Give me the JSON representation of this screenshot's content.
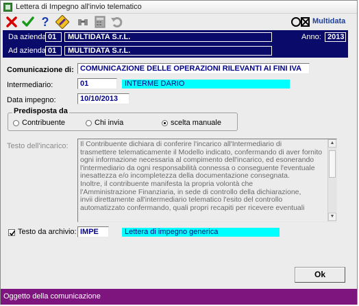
{
  "window": {
    "title": "Lettera di Impegno all'invio telematico"
  },
  "toolbar": {
    "buttons": [
      "cancel-icon",
      "confirm-icon",
      "help-icon",
      "edit-icon",
      "search-icon",
      "calculator-icon",
      "undo-icon"
    ]
  },
  "logo": {
    "text": "Multidata"
  },
  "header": {
    "da_azienda_label": "Da azienda:",
    "da_azienda_code": "01",
    "da_azienda_name": "MULTIDATA S.r.L.",
    "anno_label": "Anno:",
    "anno_value": "2013",
    "ad_azienda_label": "Ad azienda:",
    "ad_azienda_code": "01",
    "ad_azienda_name": "MULTIDATA S.r.L."
  },
  "form": {
    "comunicazione_label": "Comunicazione di:",
    "comunicazione_value": "COMUNICAZIONE DELLE OPERAZIONI RILEVANTI AI FINI IVA",
    "intermediario_label": "Intermediario:",
    "intermediario_code": "01",
    "intermediario_name": "INTERME DARIO",
    "data_impegno_label": "Data impegno:",
    "data_impegno_value": "10/10/2013",
    "predisposta_title": "Predisposta da",
    "radio_options": [
      {
        "label": "Contribuente",
        "selected": false
      },
      {
        "label": "Chi invia",
        "selected": false
      },
      {
        "label": "scelta manuale",
        "selected": true
      }
    ],
    "testo_label": "Testo dell'incarico:",
    "testo_lines": [
      "Il Contribuente dichiara di conferire l'incarico all'Intermediario di",
      "trasmettere telematicamente il Modello indicato, confermando di aver fornito",
      "ogni informazione necessaria al compimento dell'incarico, ed esonerando",
      "l'intermediario da ogni responsabilità connessa o conseguente l'eventuale",
      "inesattezza e/o incompletezza della documentazione consegnata.",
      "Inoltre, il contribuente manifesta la propria volontà che",
      "l'Amministrazione Finanziaria, in sede di controllo della dichiarazione,",
      "invii direttamente all'intermediario telematico l'esito del controllo",
      "automatizzato confermando, quali propri recapiti per ricevere eventuali"
    ],
    "archivio_checked": true,
    "archivio_label": "Testo da archivio:",
    "archivio_code": "IMPE",
    "archivio_name": "Lettera di impegno generica"
  },
  "buttons": {
    "ok_label": "Ok"
  },
  "status": {
    "text": "Oggetto della comunicazione"
  },
  "colors": {
    "header_bg": "#0a0a6b",
    "status_bg": "#7e157e",
    "highlight": "#00ffff",
    "field_text": "#00008b"
  }
}
